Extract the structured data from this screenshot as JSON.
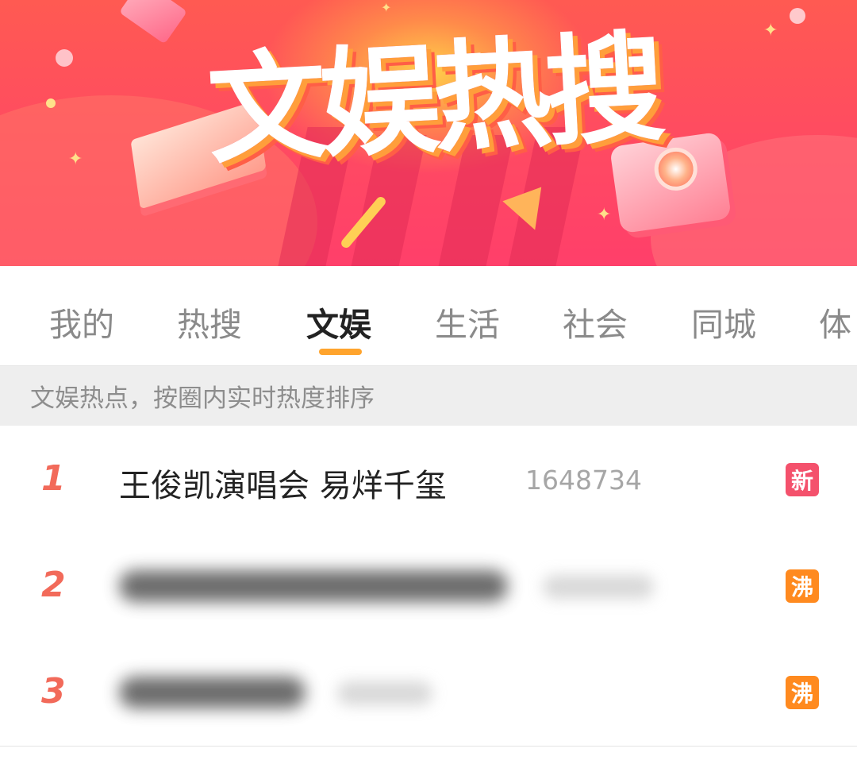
{
  "banner": {
    "title": "文娱热搜"
  },
  "tabs": [
    {
      "label": "我的",
      "active": false
    },
    {
      "label": "热搜",
      "active": false
    },
    {
      "label": "文娱",
      "active": true
    },
    {
      "label": "生活",
      "active": false
    },
    {
      "label": "社会",
      "active": false
    },
    {
      "label": "同城",
      "active": false
    },
    {
      "label": "体",
      "active": false
    }
  ],
  "notice": {
    "text": "文娱热点，按圈内实时热度排序"
  },
  "list": [
    {
      "rank": "1",
      "title": "王俊凯演唱会 易烊千玺",
      "heat": "1648734",
      "badge": "新",
      "badge_color": "#f4516c",
      "blurred": false
    },
    {
      "rank": "2",
      "badge": "沸",
      "badge_color": "#ff8a1f",
      "blurred": true
    },
    {
      "rank": "3",
      "badge": "沸",
      "badge_color": "#ff8a1f",
      "blurred": true
    }
  ],
  "colors": {
    "accent_underline": "#ffa42d",
    "rank": "#f26a5a"
  }
}
